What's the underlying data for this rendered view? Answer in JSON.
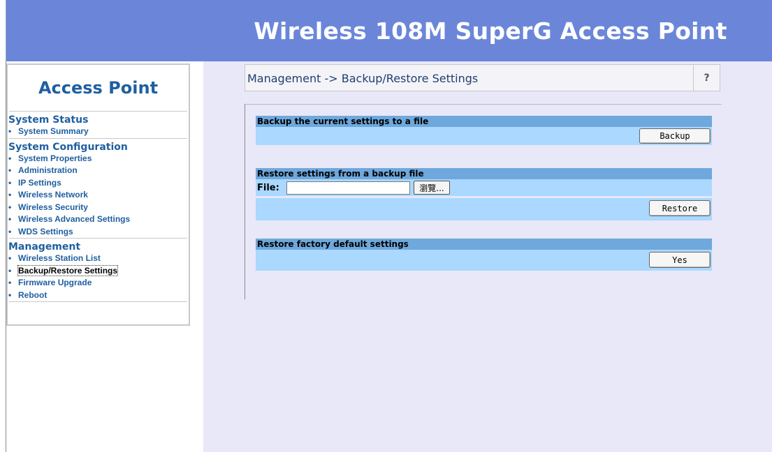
{
  "header": {
    "title": "Wireless 108M SuperG Access Point"
  },
  "sidebar": {
    "brand": "Access Point",
    "sections": [
      {
        "title": "System Status",
        "items": [
          "System Summary"
        ]
      },
      {
        "title": "System Configuration",
        "items": [
          "System Properties",
          "Administration",
          "IP Settings",
          "Wireless Network",
          "Wireless Security",
          "Wireless Advanced Settings",
          "WDS Settings"
        ]
      },
      {
        "title": "Management",
        "items": [
          "Wireless Station List",
          "Backup/Restore Settings",
          "Firmware Upgrade",
          "Reboot"
        ]
      }
    ],
    "active_item": "Backup/Restore Settings"
  },
  "main": {
    "title": "Management -> Backup/Restore Settings",
    "help": "?",
    "backup": {
      "heading": "Backup the current settings to a file",
      "button": "Backup"
    },
    "restore": {
      "heading": "Restore settings from a backup file",
      "file_label": "File:",
      "file_value": "",
      "browse_button": "瀏覽...",
      "button": "Restore"
    },
    "factory": {
      "heading": "Restore factory default settings",
      "button": "Yes"
    }
  }
}
